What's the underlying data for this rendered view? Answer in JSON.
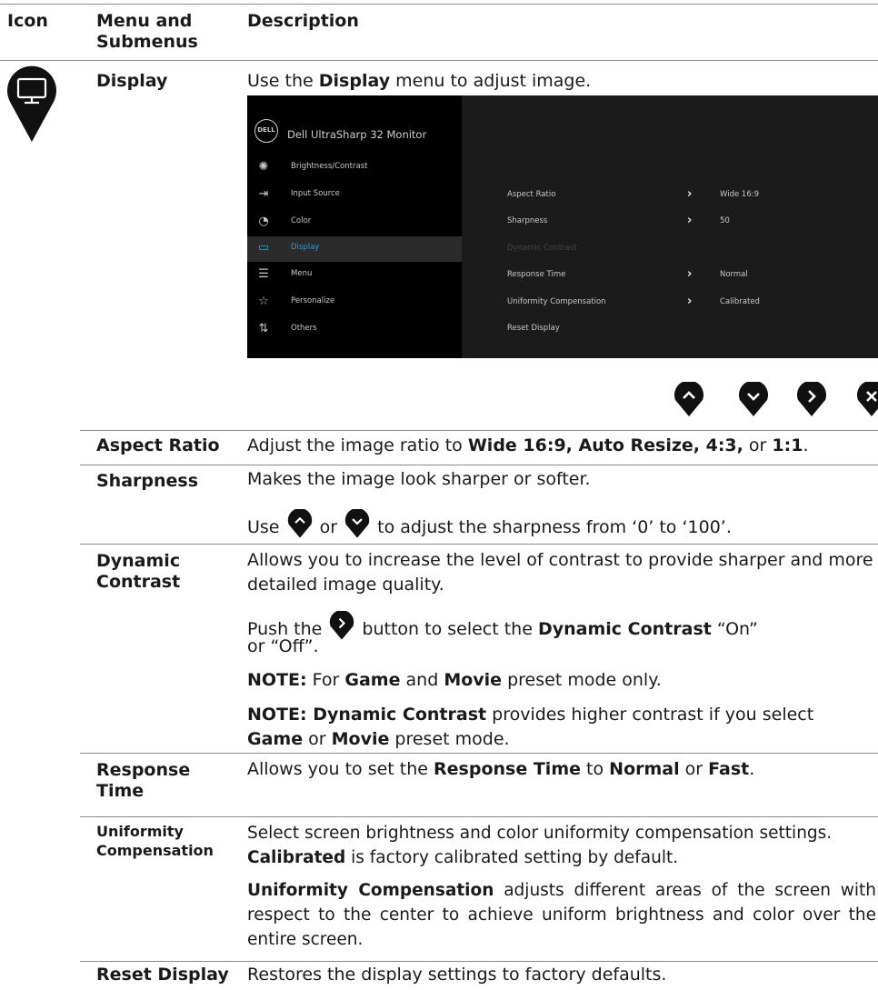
{
  "header": {
    "icon": "Icon",
    "menu": "Menu and Submenus",
    "description": "Description"
  },
  "display_section": {
    "label": "Display",
    "intro_pre": "Use the ",
    "intro_bold": "Display",
    "intro_post": " menu to adjust image.",
    "icon": "monitor-icon"
  },
  "osd": {
    "brand": "Dell UltraSharp 32 Monitor",
    "logo_text": "DELL",
    "menu_items": [
      {
        "label": "Brightness/Contrast",
        "icon": "sun-icon"
      },
      {
        "label": "Input Source",
        "icon": "input-icon"
      },
      {
        "label": "Color",
        "icon": "palette-icon"
      },
      {
        "label": "Display",
        "icon": "monitor-icon"
      },
      {
        "label": "Menu",
        "icon": "menu-icon"
      },
      {
        "label": "Personalize",
        "icon": "star-icon"
      },
      {
        "label": "Others",
        "icon": "others-icon"
      }
    ],
    "settings": [
      {
        "label": "Aspect Ratio",
        "value": "Wide 16:9"
      },
      {
        "label": "Sharpness",
        "value": "50"
      },
      {
        "label": "Dynamic Contrast",
        "value": ""
      },
      {
        "label": "Response Time",
        "value": "Normal"
      },
      {
        "label": "Uniformity Compensation",
        "value": "Calibrated"
      },
      {
        "label": "Reset Display",
        "value": ""
      }
    ]
  },
  "nav_buttons": [
    "up-icon",
    "down-icon",
    "right-icon",
    "close-icon"
  ],
  "rows": {
    "aspect_ratio": {
      "label": "Aspect Ratio",
      "pre": "Adjust the image ratio to ",
      "bold1": "Wide 16:9, Auto Resize, 4:3,",
      "mid": " or ",
      "bold2": "1:1",
      "post": "."
    },
    "sharpness": {
      "label": "Sharpness",
      "line1": "Makes the image look sharper or softer.",
      "use": "Use",
      "or": "or",
      "line2_post": "to adjust the sharpness from ‘0’ to ‘100’."
    },
    "dynamic_contrast": {
      "label_line1": "Dynamic",
      "label_line2": "Contrast",
      "para1": "Allows you to increase the level of contrast to provide sharper and more detailed image quality.",
      "push_pre": "Push the",
      "push_mid": "button to select the ",
      "push_bold": "Dynamic Contrast",
      "push_post": " “On”",
      "push_line2": "or “Off”.",
      "note1_label": "NOTE:",
      "note1_pre": " For ",
      "note1_game": "Game",
      "note1_and": " and ",
      "note1_movie": "Movie",
      "note1_post": " preset mode only.",
      "note2_label": "NOTE: Dynamic Contrast",
      "note2_text": " provides higher contrast if you select",
      "note2_game": "Game",
      "note2_or": " or ",
      "note2_movie": "Movie",
      "note2_post": " preset mode."
    },
    "response_time": {
      "label_line1": "Response",
      "label_line2": "Time",
      "pre": "Allows you to set the ",
      "bold1": "Response Time",
      "mid": " to ",
      "bold2": "Normal",
      "or": " or ",
      "bold3": "Fast",
      "post": "."
    },
    "uniformity": {
      "label_line1": "Uniformity",
      "label_line2": "Compensation",
      "line1": "Select screen brightness and color uniformity compensation settings.",
      "line2_bold": "Calibrated",
      "line2_post": " is factory calibrated setting by default.",
      "para2_bold": "Uniformity Compensation",
      "para2_post": " adjusts different areas of the screen with respect to the center to achieve uniform brightness and color over the entire screen."
    },
    "reset_display": {
      "label": "Reset Display",
      "text": "Restores the display settings to factory defaults."
    }
  }
}
